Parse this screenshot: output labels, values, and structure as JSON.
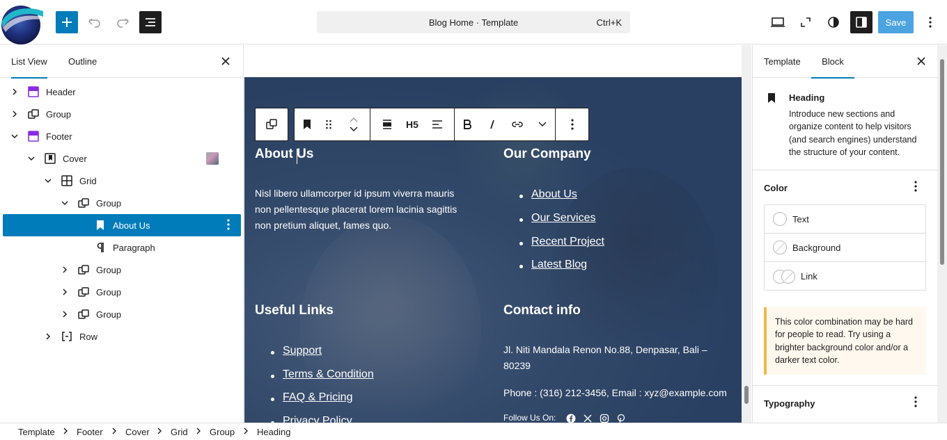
{
  "header": {
    "doc_title": "Blog Home · Template",
    "shortcut": "Ctrl+K",
    "save_label": "Save"
  },
  "left_panel": {
    "tabs": [
      "List View",
      "Outline"
    ],
    "tree": [
      {
        "label": "Header",
        "depth": 0,
        "expand": "collapsed",
        "icon": "template-part-icon"
      },
      {
        "label": "Group",
        "depth": 0,
        "expand": "collapsed",
        "icon": "group-icon"
      },
      {
        "label": "Footer",
        "depth": 0,
        "expand": "expanded",
        "icon": "template-part-icon"
      },
      {
        "label": "Cover",
        "depth": 1,
        "expand": "expanded",
        "icon": "cover-icon"
      },
      {
        "label": "Grid",
        "depth": 2,
        "expand": "expanded",
        "icon": "grid-icon"
      },
      {
        "label": "Group",
        "depth": 3,
        "expand": "expanded",
        "icon": "group-icon"
      },
      {
        "label": "About Us",
        "depth": 4,
        "expand": "none",
        "icon": "heading-icon",
        "selected": true
      },
      {
        "label": "Paragraph",
        "depth": 4,
        "expand": "none",
        "icon": "paragraph-icon"
      },
      {
        "label": "Group",
        "depth": 3,
        "expand": "collapsed",
        "icon": "group-icon"
      },
      {
        "label": "Group",
        "depth": 3,
        "expand": "collapsed",
        "icon": "group-icon"
      },
      {
        "label": "Group",
        "depth": 3,
        "expand": "collapsed",
        "icon": "group-icon"
      },
      {
        "label": "Row",
        "depth": 2,
        "expand": "collapsed",
        "icon": "row-icon"
      }
    ]
  },
  "block_toolbar": {
    "heading_level": "H5"
  },
  "canvas": {
    "about": {
      "title": "About Us",
      "text": "Nisl libero ullamcorper id ipsum viverra mauris non pellentesque placerat lorem lacinia sagittis non pretium aliquet, fames quo."
    },
    "company": {
      "title": "Our Company",
      "links": [
        "About Us",
        "Our Services",
        "Recent Project",
        "Latest Blog"
      ]
    },
    "useful": {
      "title": "Useful Links",
      "links": [
        "Support",
        "Terms & Condition",
        "FAQ & Pricing",
        "Privacy Policy"
      ]
    },
    "contact": {
      "title": "Contact info",
      "address": "Jl. Niti Mandala Renon No.88, Denpasar, Bali – 80239",
      "phone": "Phone : (316) 212-3456, Email : xyz@example.com",
      "follow": "Follow Us On:"
    }
  },
  "right_panel": {
    "tabs": [
      "Template",
      "Block"
    ],
    "block_name": "Heading",
    "block_desc": "Introduce new sections and organize content to help visitors (and search engines) understand the structure of your content.",
    "color_title": "Color",
    "color_items": [
      "Text",
      "Background",
      "Link"
    ],
    "notice": "This color combination may be hard for people to read. Try using a brighter background color and/or a darker text color.",
    "typography_title": "Typography"
  },
  "breadcrumb": [
    "Template",
    "Footer",
    "Cover",
    "Grid",
    "Group",
    "Heading"
  ],
  "colors": {
    "accent": "#007cba",
    "save_bg": "#4ba3e0",
    "notice_border": "#f0b849"
  }
}
